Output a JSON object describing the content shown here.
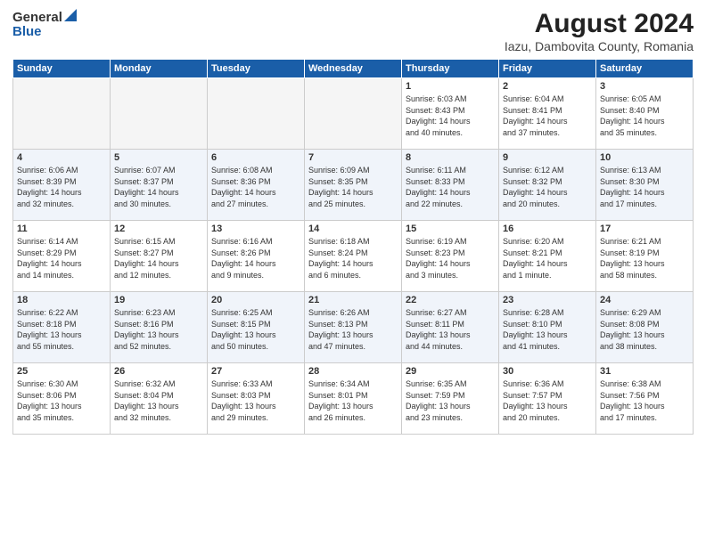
{
  "header": {
    "logo_general": "General",
    "logo_blue": "Blue",
    "title": "August 2024",
    "location": "Iazu, Dambovita County, Romania"
  },
  "columns": [
    "Sunday",
    "Monday",
    "Tuesday",
    "Wednesday",
    "Thursday",
    "Friday",
    "Saturday"
  ],
  "weeks": [
    [
      {
        "day": "",
        "info": ""
      },
      {
        "day": "",
        "info": ""
      },
      {
        "day": "",
        "info": ""
      },
      {
        "day": "",
        "info": ""
      },
      {
        "day": "1",
        "info": "Sunrise: 6:03 AM\nSunset: 8:43 PM\nDaylight: 14 hours\nand 40 minutes."
      },
      {
        "day": "2",
        "info": "Sunrise: 6:04 AM\nSunset: 8:41 PM\nDaylight: 14 hours\nand 37 minutes."
      },
      {
        "day": "3",
        "info": "Sunrise: 6:05 AM\nSunset: 8:40 PM\nDaylight: 14 hours\nand 35 minutes."
      }
    ],
    [
      {
        "day": "4",
        "info": "Sunrise: 6:06 AM\nSunset: 8:39 PM\nDaylight: 14 hours\nand 32 minutes."
      },
      {
        "day": "5",
        "info": "Sunrise: 6:07 AM\nSunset: 8:37 PM\nDaylight: 14 hours\nand 30 minutes."
      },
      {
        "day": "6",
        "info": "Sunrise: 6:08 AM\nSunset: 8:36 PM\nDaylight: 14 hours\nand 27 minutes."
      },
      {
        "day": "7",
        "info": "Sunrise: 6:09 AM\nSunset: 8:35 PM\nDaylight: 14 hours\nand 25 minutes."
      },
      {
        "day": "8",
        "info": "Sunrise: 6:11 AM\nSunset: 8:33 PM\nDaylight: 14 hours\nand 22 minutes."
      },
      {
        "day": "9",
        "info": "Sunrise: 6:12 AM\nSunset: 8:32 PM\nDaylight: 14 hours\nand 20 minutes."
      },
      {
        "day": "10",
        "info": "Sunrise: 6:13 AM\nSunset: 8:30 PM\nDaylight: 14 hours\nand 17 minutes."
      }
    ],
    [
      {
        "day": "11",
        "info": "Sunrise: 6:14 AM\nSunset: 8:29 PM\nDaylight: 14 hours\nand 14 minutes."
      },
      {
        "day": "12",
        "info": "Sunrise: 6:15 AM\nSunset: 8:27 PM\nDaylight: 14 hours\nand 12 minutes."
      },
      {
        "day": "13",
        "info": "Sunrise: 6:16 AM\nSunset: 8:26 PM\nDaylight: 14 hours\nand 9 minutes."
      },
      {
        "day": "14",
        "info": "Sunrise: 6:18 AM\nSunset: 8:24 PM\nDaylight: 14 hours\nand 6 minutes."
      },
      {
        "day": "15",
        "info": "Sunrise: 6:19 AM\nSunset: 8:23 PM\nDaylight: 14 hours\nand 3 minutes."
      },
      {
        "day": "16",
        "info": "Sunrise: 6:20 AM\nSunset: 8:21 PM\nDaylight: 14 hours\nand 1 minute."
      },
      {
        "day": "17",
        "info": "Sunrise: 6:21 AM\nSunset: 8:19 PM\nDaylight: 13 hours\nand 58 minutes."
      }
    ],
    [
      {
        "day": "18",
        "info": "Sunrise: 6:22 AM\nSunset: 8:18 PM\nDaylight: 13 hours\nand 55 minutes."
      },
      {
        "day": "19",
        "info": "Sunrise: 6:23 AM\nSunset: 8:16 PM\nDaylight: 13 hours\nand 52 minutes."
      },
      {
        "day": "20",
        "info": "Sunrise: 6:25 AM\nSunset: 8:15 PM\nDaylight: 13 hours\nand 50 minutes."
      },
      {
        "day": "21",
        "info": "Sunrise: 6:26 AM\nSunset: 8:13 PM\nDaylight: 13 hours\nand 47 minutes."
      },
      {
        "day": "22",
        "info": "Sunrise: 6:27 AM\nSunset: 8:11 PM\nDaylight: 13 hours\nand 44 minutes."
      },
      {
        "day": "23",
        "info": "Sunrise: 6:28 AM\nSunset: 8:10 PM\nDaylight: 13 hours\nand 41 minutes."
      },
      {
        "day": "24",
        "info": "Sunrise: 6:29 AM\nSunset: 8:08 PM\nDaylight: 13 hours\nand 38 minutes."
      }
    ],
    [
      {
        "day": "25",
        "info": "Sunrise: 6:30 AM\nSunset: 8:06 PM\nDaylight: 13 hours\nand 35 minutes."
      },
      {
        "day": "26",
        "info": "Sunrise: 6:32 AM\nSunset: 8:04 PM\nDaylight: 13 hours\nand 32 minutes."
      },
      {
        "day": "27",
        "info": "Sunrise: 6:33 AM\nSunset: 8:03 PM\nDaylight: 13 hours\nand 29 minutes."
      },
      {
        "day": "28",
        "info": "Sunrise: 6:34 AM\nSunset: 8:01 PM\nDaylight: 13 hours\nand 26 minutes."
      },
      {
        "day": "29",
        "info": "Sunrise: 6:35 AM\nSunset: 7:59 PM\nDaylight: 13 hours\nand 23 minutes."
      },
      {
        "day": "30",
        "info": "Sunrise: 6:36 AM\nSunset: 7:57 PM\nDaylight: 13 hours\nand 20 minutes."
      },
      {
        "day": "31",
        "info": "Sunrise: 6:38 AM\nSunset: 7:56 PM\nDaylight: 13 hours\nand 17 minutes."
      }
    ]
  ]
}
